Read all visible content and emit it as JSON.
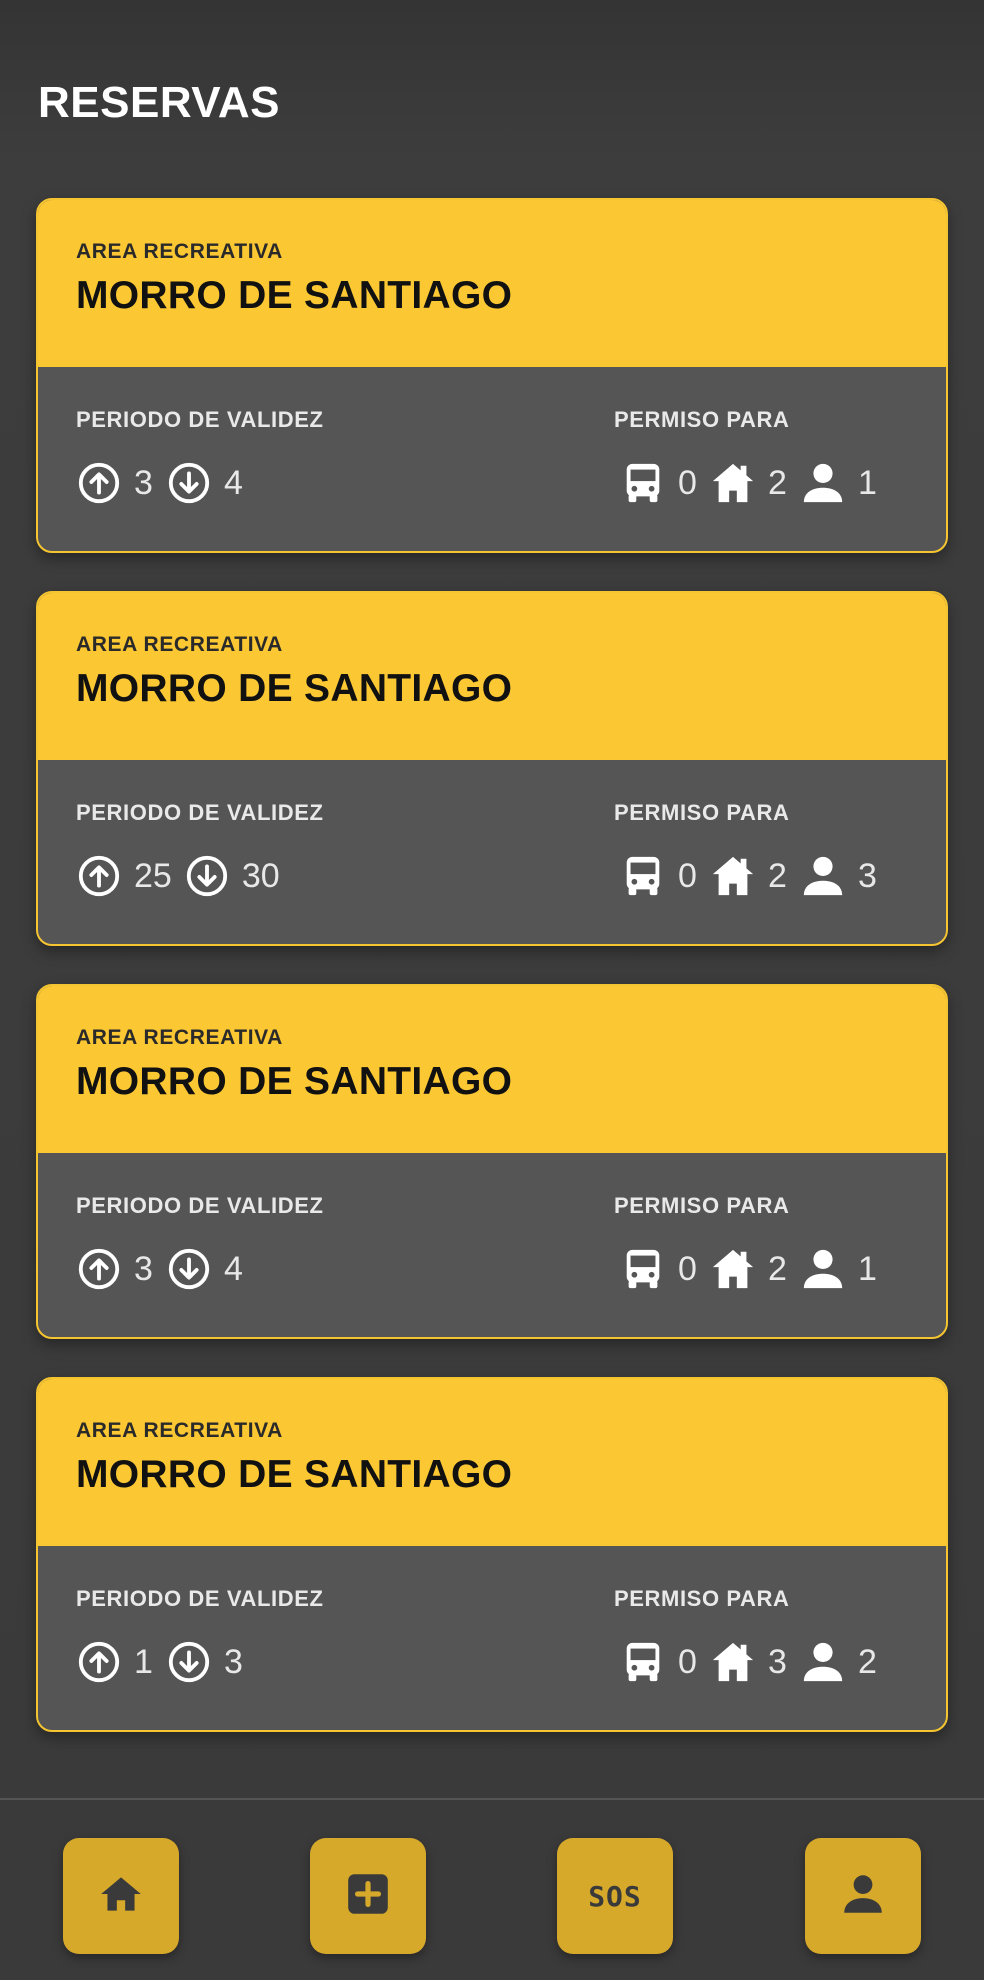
{
  "page": {
    "title": "RESERVAS"
  },
  "labels": {
    "kicker": "AREA RECREATIVA",
    "period": "PERIODO DE VALIDEZ",
    "permit": "PERMISO PARA"
  },
  "cards": [
    {
      "title": "MORRO DE SANTIAGO",
      "up": "3",
      "down": "4",
      "bus": "0",
      "house": "2",
      "person": "1"
    },
    {
      "title": "MORRO DE SANTIAGO",
      "up": "25",
      "down": "30",
      "bus": "0",
      "house": "2",
      "person": "3"
    },
    {
      "title": "MORRO DE SANTIAGO",
      "up": "3",
      "down": "4",
      "bus": "0",
      "house": "2",
      "person": "1"
    },
    {
      "title": "MORRO DE SANTIAGO",
      "up": "1",
      "down": "3",
      "bus": "0",
      "house": "3",
      "person": "2"
    }
  ],
  "nav": {
    "sos_label": "SOS"
  },
  "colors": {
    "accent": "#fbc733",
    "card_body": "#555555",
    "background": "#3b3b3b",
    "nav_button": "#d6a92b"
  },
  "icons": [
    "arrow-up-circle-icon",
    "arrow-down-circle-icon",
    "bus-icon",
    "house-icon",
    "person-icon",
    "home-icon",
    "plus-square-icon",
    "user-icon"
  ]
}
